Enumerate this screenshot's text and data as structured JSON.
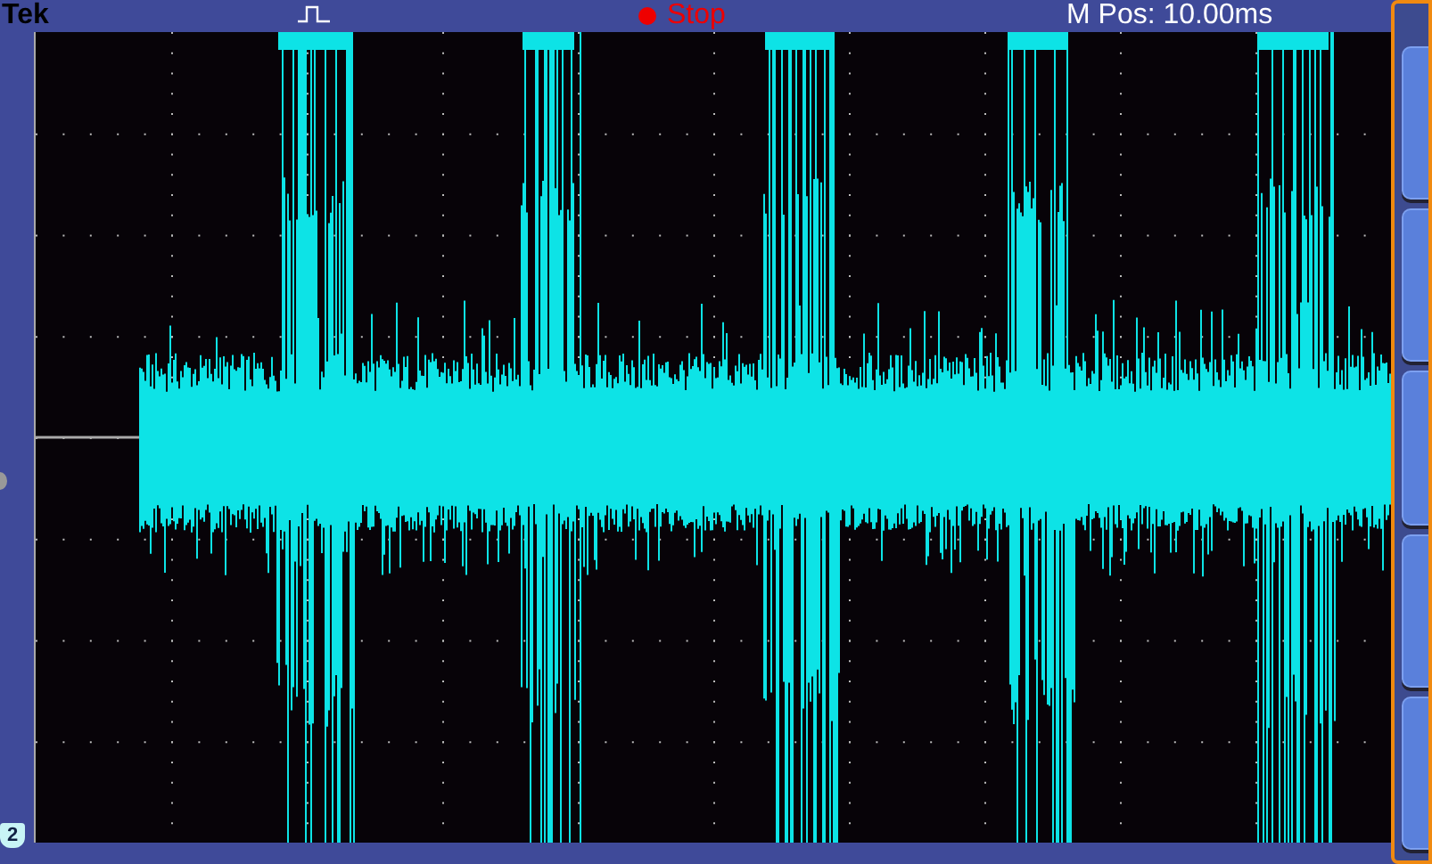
{
  "header": {
    "brand": "Tek",
    "acquisition_status": "Stop",
    "position": "M Pos: 10.00ms"
  },
  "channel": {
    "label": "2"
  }
}
